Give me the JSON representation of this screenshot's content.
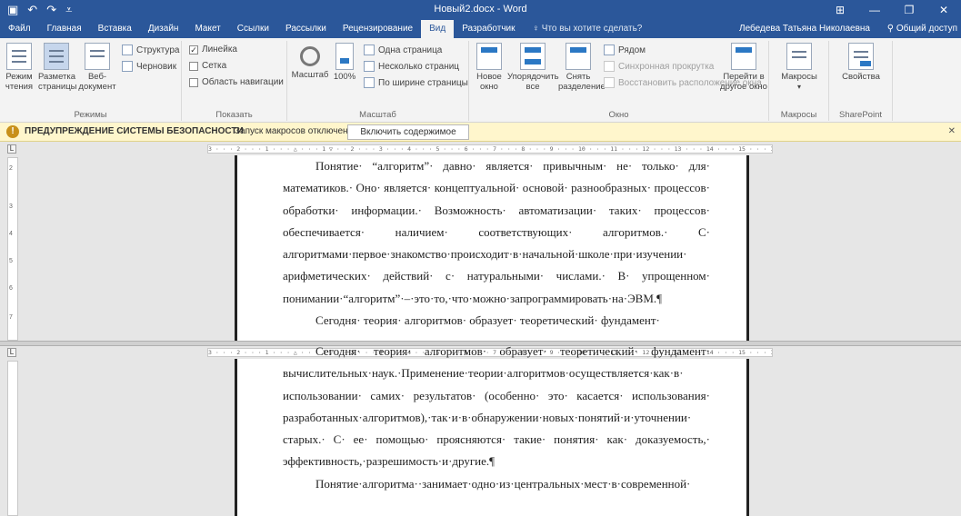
{
  "titlebar": {
    "title": "Новый2.docx - Word",
    "save_icon": "save-icon",
    "undo_icon": "undo-icon",
    "redo_icon": "redo-icon"
  },
  "menu": {
    "tabs": [
      "Файл",
      "Главная",
      "Вставка",
      "Дизайн",
      "Макет",
      "Ссылки",
      "Рассылки",
      "Рецензирование",
      "Вид",
      "Разработчик"
    ],
    "active_tab": "Вид",
    "search": "Что вы хотите сделать?",
    "user": "Лебедева Татьяна Николаевна",
    "share": "Общий доступ"
  },
  "ribbon": {
    "modes": {
      "read_label": "Режим чтения",
      "layout_label": "Разметка страницы",
      "web_label": "Веб-документ",
      "structure_label": "Структура",
      "draft_label": "Черновик",
      "group_label": "Режимы"
    },
    "show": {
      "ruler_label": "Линейка",
      "ruler_checked": true,
      "grid_label": "Сетка",
      "grid_checked": false,
      "nav_label": "Область навигации",
      "nav_checked": false,
      "group_label": "Показать"
    },
    "zoom": {
      "zoom_label": "Масштаб",
      "percent_label": "100%",
      "one_page_label": "Одна страница",
      "multi_page_label": "Несколько страниц",
      "page_width_label": "По ширине страницы",
      "group_label": "Масштаб"
    },
    "window": {
      "new_window_label": "Новое окно",
      "arrange_all_label": "Упорядочить все",
      "split_label": "Снять разделение",
      "side_by_side_label": "Рядом",
      "sync_scroll_label": "Синхронная прокрутка",
      "reset_position_label": "Восстановить расположение окна",
      "switch_window_label": "Перейти в другое окно",
      "group_label": "Окно"
    },
    "macros": {
      "macros_label": "Макросы",
      "group_label": "Макросы"
    },
    "sharepoint": {
      "properties_label": "Свойства",
      "group_label": "SharePoint"
    }
  },
  "security": {
    "title": "ПРЕДУПРЕЖДЕНИЕ СИСТЕМЫ БЕЗОПАСНОСТИ",
    "message": "Запуск макросов отключен.",
    "button": "Включить содержимое"
  },
  "ruler": {
    "top_text": "3 · · · 2 · · · 1 · · · △ · · · 1 ▽ · · 2 · · · 3 · · · 4 · · · 5 · · · 6 · · · 7 · · · 8 · · · 9 · · · 10 · · · 11 · · · 12 · · · 13 · · · 14 · · · 15 · · · 16 · △ ·17 · · ·",
    "bottom_text": "3 · · · 2 · · · 1 · · · △ · · · 1 ▽ · · 2 · · · 3 · · · 4 · · · 5 · · · 6 · · · 7 · · · 8 · · · 9 · · · 10 · · · 11 · · · 12 · · · 13 · · · 14 · · · 15 · · · 16 · △ ·17 · · ·",
    "corner": "L",
    "vticks": [
      "2",
      "1",
      "3",
      "4",
      "5",
      "6",
      "7",
      "8"
    ]
  },
  "document": {
    "pane1_p1": "Понятие· “алгоритм”· давно· является· привычным· не· только· для· математиков.· Оно· является· концептуальной· основой· разнообразных· процессов· обработки· информации.· Возможность· автоматизации· таких· процессов· обеспечивается· наличием· соответствующих· алгоритмов.· С· алгоритмами·первое·знакомство·происходит·в·начальной·школе·при·изучении· арифметических· действий· с· натуральными· числами.· В· упрощенном· понимании·“алгоритм”·–·это·то,·что·можно·запрограммировать·на·ЭВМ.¶",
    "pane1_p2": "Сегодня· теория· алгоритмов· образует· теоретический· фундамент·",
    "pane2_p1_cont": "Сегодня· теория· алгоритмов· образует· теоретический· фундамент· вычислительных·наук.·Применение·теории·алгоритмов·осуществляется·как·в· использовании· самих· результатов· (особенно· это· касается· использования· разработанных·алгоритмов),·так·и·в·обнаружении·новых·понятий·и·уточнении· старых.· С· ее· помощью· проясняются· такие· понятия· как· доказуемость,· эффективность,·разрешимость·и·другие.¶",
    "pane2_p2": "Понятие·алгоритма··занимает·одно·из·центральных·мест·в·современной·"
  }
}
